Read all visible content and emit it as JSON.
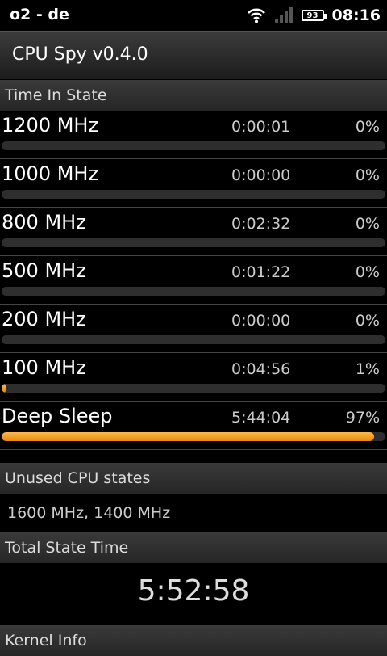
{
  "status_bar": {
    "carrier": "o2 - de",
    "battery": "93",
    "time": "08:16"
  },
  "app": {
    "title": "CPU Spy v0.4.0"
  },
  "time_in_state": {
    "header": "Time In State",
    "states": [
      {
        "freq": "1200 MHz",
        "time": "0:00:01",
        "percent": "0%",
        "fraction": 0.0
      },
      {
        "freq": "1000 MHz",
        "time": "0:00:00",
        "percent": "0%",
        "fraction": 0.0
      },
      {
        "freq": "800 MHz",
        "time": "0:02:32",
        "percent": "0%",
        "fraction": 0.0
      },
      {
        "freq": "500 MHz",
        "time": "0:01:22",
        "percent": "0%",
        "fraction": 0.0
      },
      {
        "freq": "200 MHz",
        "time": "0:00:00",
        "percent": "0%",
        "fraction": 0.0
      },
      {
        "freq": "100 MHz",
        "time": "0:04:56",
        "percent": "1%",
        "fraction": 0.01
      },
      {
        "freq": "Deep Sleep",
        "time": "5:44:04",
        "percent": "97%",
        "fraction": 0.97
      }
    ]
  },
  "unused": {
    "header": "Unused CPU states",
    "list": "1600 MHz, 1400 MHz"
  },
  "total": {
    "header": "Total State Time",
    "value": "5:52:58"
  },
  "kernel": {
    "header": "Kernel Info"
  },
  "colors": {
    "bar_fill": "#f0961e",
    "bar_track": "#2e2e2e"
  }
}
